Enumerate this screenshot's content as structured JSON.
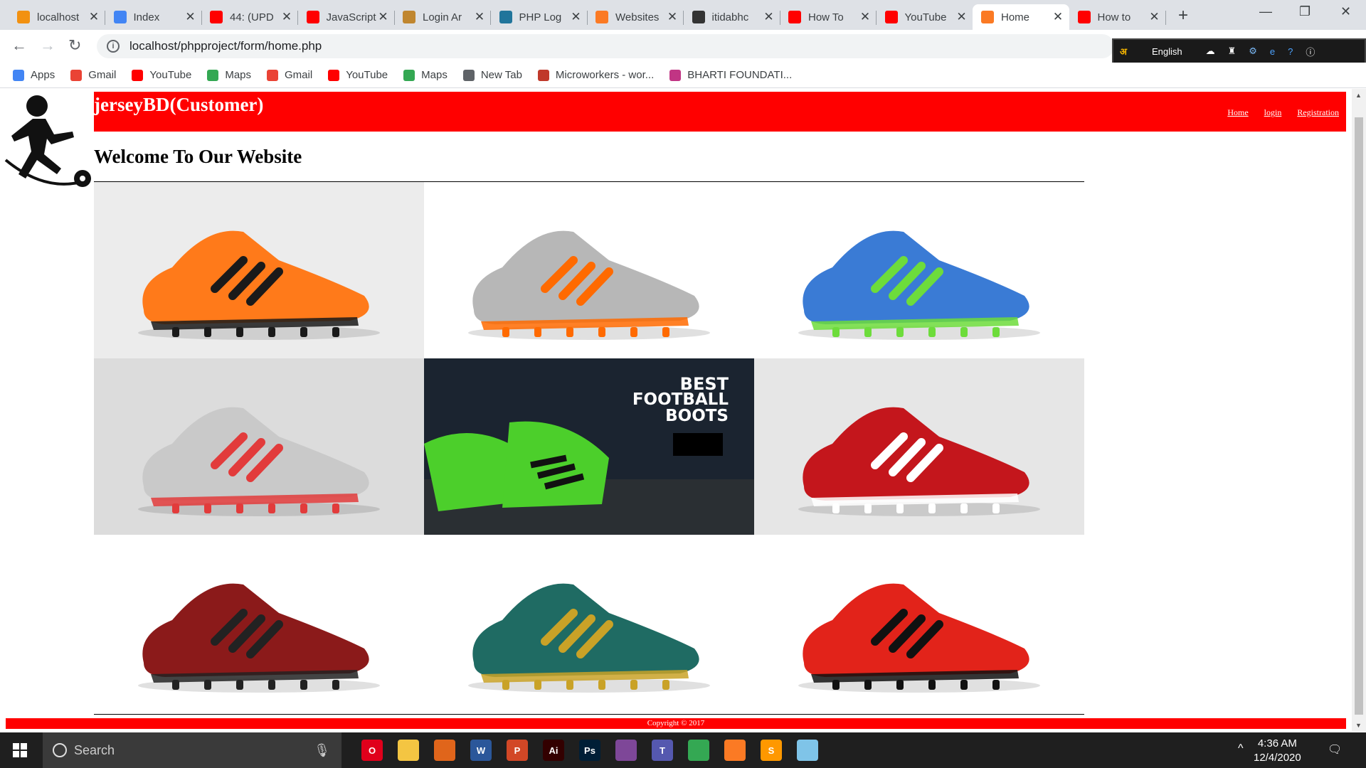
{
  "browser": {
    "tabs": [
      {
        "title": "localhost",
        "icon": "phpmyadmin-icon",
        "color": "#f29111"
      },
      {
        "title": "Index",
        "icon": "globe-icon",
        "color": "#4285f4"
      },
      {
        "title": "44: (UPD",
        "icon": "youtube-icon",
        "color": "#ff0000"
      },
      {
        "title": "JavaScript",
        "icon": "youtube-icon",
        "color": "#ff0000"
      },
      {
        "title": "Login Ar",
        "icon": "avatar-icon",
        "color": "#c0862f"
      },
      {
        "title": "PHP Log",
        "icon": "w-icon",
        "color": "#21759b"
      },
      {
        "title": "Websites",
        "icon": "xampp-icon",
        "color": "#fb7a24"
      },
      {
        "title": "itidabhc",
        "icon": "github-icon",
        "color": "#333333"
      },
      {
        "title": "How To",
        "icon": "youtube-icon",
        "color": "#ff0000"
      },
      {
        "title": "YouTube",
        "icon": "youtube-icon",
        "color": "#ff0000"
      },
      {
        "title": "Home",
        "icon": "xampp-icon",
        "color": "#fb7a24",
        "active": true
      },
      {
        "title": "How to",
        "icon": "youtube-icon",
        "color": "#ff0000"
      }
    ],
    "url": "localhost/phpproject/form/home.php",
    "extension": {
      "language": "English"
    },
    "bookmarks": [
      {
        "label": "Apps",
        "icon": "apps-grid-icon",
        "color": "#4285f4"
      },
      {
        "label": "Gmail",
        "icon": "gmail-icon",
        "color": "#ea4335"
      },
      {
        "label": "YouTube",
        "icon": "youtube-icon",
        "color": "#ff0000"
      },
      {
        "label": "Maps",
        "icon": "maps-pin-icon",
        "color": "#34a853"
      },
      {
        "label": "Gmail",
        "icon": "gmail-icon",
        "color": "#ea4335"
      },
      {
        "label": "YouTube",
        "icon": "youtube-icon",
        "color": "#ff0000"
      },
      {
        "label": "Maps",
        "icon": "maps-pin-icon",
        "color": "#34a853"
      },
      {
        "label": "New Tab",
        "icon": "globe-icon",
        "color": "#5f6368"
      },
      {
        "label": "Microworkers - wor...",
        "icon": "w-icon",
        "color": "#c0392b"
      },
      {
        "label": "BHARTI FOUNDATI...",
        "icon": "instagram-icon",
        "color": "#c13584"
      }
    ]
  },
  "site": {
    "brand": "jerseyBD(Customer)",
    "nav": [
      "Home",
      "login",
      "Registration"
    ],
    "welcome": "Welcome To Our Website",
    "banner_text": [
      "BEST",
      "FOOTBALL",
      "BOOTS"
    ],
    "footer": "Copyright © 2017",
    "accent": "#ff0000"
  },
  "gallery": [
    {
      "name": "orange-sock-boot",
      "bg": "#ececec",
      "upper": "#ff7a1a",
      "stripe": "#1a1a1a"
    },
    {
      "name": "silver-orange-boot",
      "bg": "#ffffff",
      "upper": "#b7b7b7",
      "stripe": "#ff6a00"
    },
    {
      "name": "green-blue-boot",
      "bg": "#ffffff",
      "upper": "#3a7bd5",
      "stripe": "#6ddc3b"
    },
    {
      "name": "silver-highcut-boot",
      "bg": "#dcdcdc",
      "upper": "#c9c9c9",
      "stripe": "#e23b3b"
    },
    {
      "name": "best-football-boots-banner",
      "bg": "#1b2430",
      "upper": "#4ccf2b",
      "stripe": "#111111"
    },
    {
      "name": "red-black-laceless-boot",
      "bg": "#e6e6e6",
      "upper": "#c4161c",
      "stripe": "#ffffff"
    },
    {
      "name": "dark-red-boots",
      "bg": "#ffffff",
      "upper": "#8b1a1a",
      "stripe": "#222222"
    },
    {
      "name": "teal-gold-boots",
      "bg": "#ffffff",
      "upper": "#1f6b63",
      "stripe": "#c9a227"
    },
    {
      "name": "red-highcut-boots",
      "bg": "#ffffff",
      "upper": "#e2231a",
      "stripe": "#111111"
    }
  ],
  "taskbar": {
    "search_placeholder": "Search",
    "time": "4:36 AM",
    "date": "12/4/2020",
    "apps": [
      {
        "name": "opera-icon",
        "label": "O",
        "color": "#e0001b"
      },
      {
        "name": "file-explorer-icon",
        "label": "",
        "color": "#f4c542"
      },
      {
        "name": "matlab-icon",
        "label": "",
        "color": "#e0651b"
      },
      {
        "name": "word-icon",
        "label": "W",
        "color": "#2b579a"
      },
      {
        "name": "powerpoint-icon",
        "label": "P",
        "color": "#d24726"
      },
      {
        "name": "illustrator-icon",
        "label": "Ai",
        "color": "#330000"
      },
      {
        "name": "photoshop-icon",
        "label": "Ps",
        "color": "#001e36"
      },
      {
        "name": "tor-browser-icon",
        "label": "",
        "color": "#7e4798"
      },
      {
        "name": "teams-icon",
        "label": "T",
        "color": "#5558af"
      },
      {
        "name": "chrome-icon",
        "label": "",
        "color": "#34a853"
      },
      {
        "name": "xampp-icon",
        "label": "",
        "color": "#fb7a24"
      },
      {
        "name": "sublime-icon",
        "label": "S",
        "color": "#ff9800"
      },
      {
        "name": "notepad-icon",
        "label": "",
        "color": "#7fc4e8"
      }
    ]
  }
}
